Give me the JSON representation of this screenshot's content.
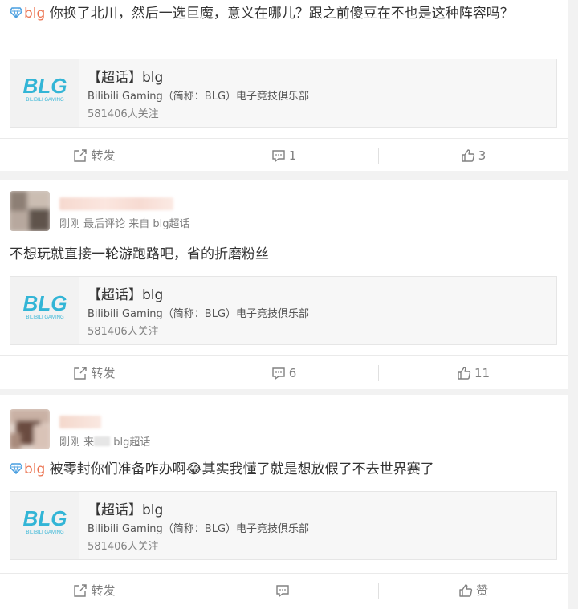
{
  "posts": [
    {
      "text_tag": "blg",
      "text_body": " 你换了北川，然后一选巨魔，意义在哪儿？跟之前傻豆在不也是这种阵容吗？",
      "link_card": {
        "title": "【超话】blg",
        "desc": "Bilibili Gaming（简称：BLG）电子竞技俱乐部",
        "count": "581406人关注"
      },
      "actions": {
        "repost": "转发",
        "comment": "1",
        "like": "3"
      }
    },
    {
      "user": {
        "meta": "刚刚 最后评论 来自 blg超话"
      },
      "text_body": "不想玩就直接一轮游跑路吧，省的折磨粉丝",
      "link_card": {
        "title": "【超话】blg",
        "desc": "Bilibili Gaming（简称：BLG）电子竞技俱乐部",
        "count": "581406人关注"
      },
      "actions": {
        "repost": "转发",
        "comment": "6",
        "like": "11"
      }
    },
    {
      "user": {
        "meta_prefix": "刚刚 来",
        "meta_suffix": " blg超话"
      },
      "text_tag": "blg",
      "text_body": " 被零封你们准备咋办啊😂其实我懂了就是想放假了不去世界赛了",
      "link_card": {
        "title": "【超话】blg",
        "desc": "Bilibili Gaming（简称：BLG）电子竞技俱乐部",
        "count": "581406人关注"
      },
      "actions": {
        "repost": "转发",
        "comment": "",
        "like": "赞"
      }
    }
  ],
  "colors": {
    "accent": "#eb7350",
    "muted": "#808080",
    "logo": "#33b5d6"
  },
  "icons": [
    "diamond-icon",
    "repost-icon",
    "comment-icon",
    "like-icon"
  ]
}
